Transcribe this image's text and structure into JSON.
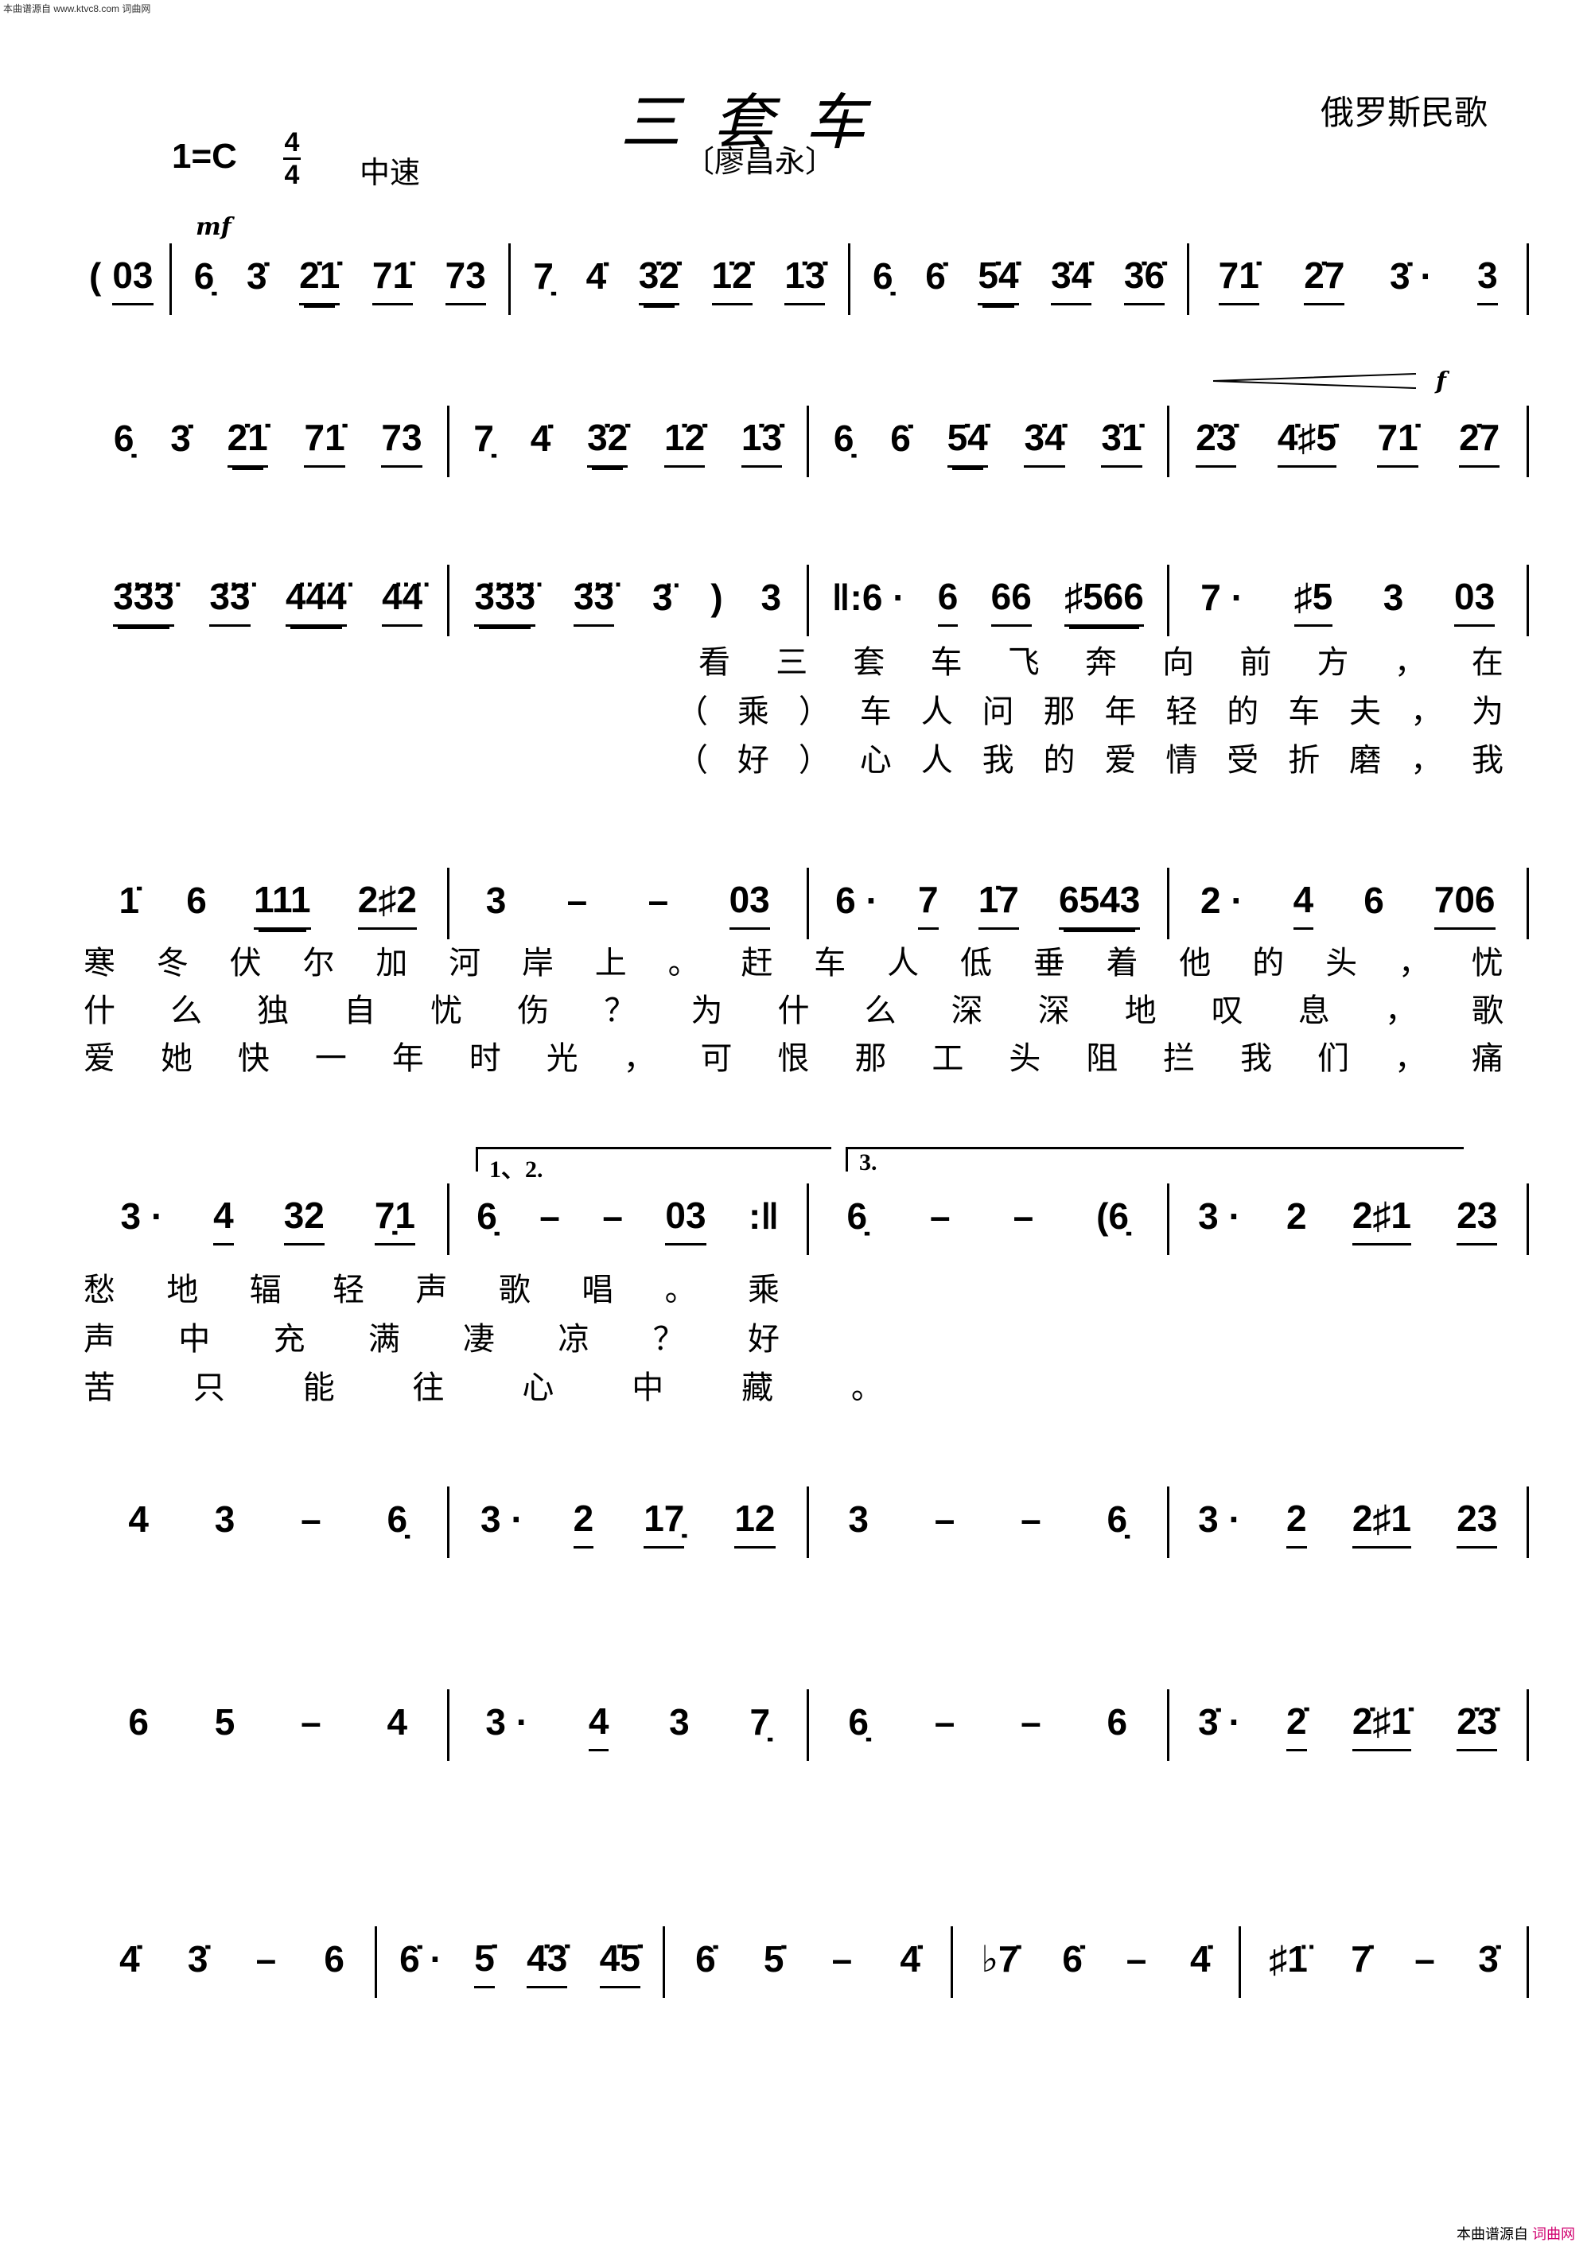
{
  "watermark_top": "本曲谱源自 www.ktvc8.com 词曲网",
  "title": "三套车",
  "composer": "俄罗斯民歌",
  "arranger": "〔廖昌永〕",
  "key": "1=C",
  "time_signature": {
    "top": "4",
    "bottom": "4"
  },
  "tempo": "中速",
  "dynamics": {
    "mf": "mf",
    "f": "f"
  },
  "voltas": {
    "first": "1、2.",
    "second": "3."
  },
  "rows": [
    {
      "lead": [
        "(",
        {
          "t": "03",
          "u": 1
        }
      ],
      "measures": [
        [
          "6̣",
          "3̇",
          {
            "t": "2̇1̇",
            "u": 2
          },
          {
            "t": "71̇",
            "u": 1
          },
          {
            "t": "73",
            "u": 1
          }
        ],
        [
          "7̣",
          "4̇",
          {
            "t": "3̇2̇",
            "u": 2
          },
          {
            "t": "1̇2̇",
            "u": 1
          },
          {
            "t": "1̇3̇",
            "u": 1
          }
        ],
        [
          "6̣",
          "6̇",
          {
            "t": "5̇4̇",
            "u": 2
          },
          {
            "t": "3̇4̇",
            "u": 1
          },
          {
            "t": "3̇6̇",
            "u": 1
          }
        ],
        [
          {
            "t": "71̇",
            "u": 1
          },
          {
            "t": "2̇7",
            "u": 1
          },
          "3̇ ·",
          {
            "t": "3",
            "u": 1
          }
        ]
      ]
    },
    {
      "lead": [],
      "measures": [
        [
          "6̣",
          "3̇",
          {
            "t": "2̇1̇",
            "u": 2
          },
          {
            "t": "71̇",
            "u": 1
          },
          {
            "t": "73",
            "u": 1
          }
        ],
        [
          "7̣",
          "4̇",
          {
            "t": "3̇2̇",
            "u": 2
          },
          {
            "t": "1̇2̇",
            "u": 1
          },
          {
            "t": "1̇3̇",
            "u": 1
          }
        ],
        [
          "6̣",
          "6̇",
          {
            "t": "5̇4̇",
            "u": 2
          },
          {
            "t": "3̇4̇",
            "u": 1
          },
          {
            "t": "3̇1̇",
            "u": 1
          }
        ],
        [
          {
            "t": "2̇3̇",
            "u": 1
          },
          {
            "t": "4̇♯5̇",
            "u": 1
          },
          {
            "t": "71̇",
            "u": 1
          },
          {
            "t": "2̇7",
            "u": 1
          }
        ]
      ]
    },
    {
      "lead": [],
      "measures": [
        [
          {
            "t": "3̈3̈3̈",
            "u": 2
          },
          {
            "t": "3̈3̈",
            "u": 1
          },
          {
            "t": "4̈4̈4̈",
            "u": 2
          },
          {
            "t": "4̈4̈",
            "u": 1
          }
        ],
        [
          {
            "t": "3̈3̈3̈",
            "u": 2
          },
          {
            "t": "3̈3̈",
            "u": 1
          },
          "3̈",
          ")",
          "3"
        ],
        [
          "‖:6 ·",
          {
            "t": "6",
            "u": 1
          },
          {
            "t": "66",
            "u": 1
          },
          {
            "t": "♯566",
            "u": 2
          }
        ],
        [
          "7 ·",
          {
            "t": "♯5",
            "u": 1
          },
          "3",
          {
            "t": "03",
            "u": 1
          }
        ]
      ]
    },
    {
      "lead": [],
      "measures": [
        [
          "1̇",
          "6",
          {
            "t": "111",
            "u": 2
          },
          {
            "t": "2♯2",
            "u": 1
          }
        ],
        [
          "3",
          "–",
          "–",
          {
            "t": "03",
            "u": 1
          }
        ],
        [
          "6 ·",
          {
            "t": "7",
            "u": 1
          },
          {
            "t": "1̇7",
            "u": 1
          },
          {
            "t": "6543",
            "u": 2
          }
        ],
        [
          "2 ·",
          {
            "t": "4",
            "u": 1
          },
          "6",
          {
            "t": "706",
            "u": 1
          }
        ]
      ]
    },
    {
      "lead": [],
      "measures": [
        [
          "3 ·",
          {
            "t": "4",
            "u": 1
          },
          {
            "t": "32",
            "u": 1
          },
          {
            "t": "7̣1",
            "u": 1
          }
        ],
        [
          "6̣",
          "–",
          "–",
          {
            "t": "03",
            "u": 1
          },
          ":‖"
        ],
        [
          "6̣",
          "–",
          "–",
          "(6̣"
        ],
        [
          "3 ·",
          "2",
          {
            "t": "2♯1",
            "u": 1
          },
          {
            "t": "23",
            "u": 1
          }
        ]
      ]
    },
    {
      "lead": [],
      "measures": [
        [
          "4",
          "3",
          "–",
          "6̣"
        ],
        [
          "3 ·",
          {
            "t": "2",
            "u": 1
          },
          {
            "t": "17̣",
            "u": 1
          },
          {
            "t": "12",
            "u": 1
          }
        ],
        [
          "3",
          "–",
          "–",
          "6̣"
        ],
        [
          "3 ·",
          {
            "t": "2",
            "u": 1
          },
          {
            "t": "2♯1",
            "u": 1
          },
          {
            "t": "23",
            "u": 1
          }
        ]
      ]
    },
    {
      "lead": [],
      "measures": [
        [
          "6",
          "5",
          "–",
          "4"
        ],
        [
          "3 ·",
          {
            "t": "4",
            "u": 1
          },
          "3",
          "7̣"
        ],
        [
          "6̣",
          "–",
          "–",
          "6"
        ],
        [
          "3̇ ·",
          {
            "t": "2̇",
            "u": 1
          },
          {
            "t": "2̇♯1̇",
            "u": 1
          },
          {
            "t": "2̇3̇",
            "u": 1
          }
        ]
      ]
    },
    {
      "lead": [],
      "measures": [
        [
          "4̇",
          "3̇",
          "–",
          "6"
        ],
        [
          "6̇ ·",
          {
            "t": "5̇",
            "u": 1
          },
          {
            "t": "4̇3̇",
            "u": 1
          },
          {
            "t": "4̇5̇",
            "u": 1
          }
        ],
        [
          "6̇",
          "5̇",
          "–",
          "4̇"
        ],
        [
          "♭7̇",
          "6̇",
          "–",
          "4̇"
        ],
        [
          "♯1̈",
          "7̇",
          "–",
          "3̇"
        ]
      ]
    }
  ],
  "lyrics": {
    "row3": [
      "看三套车飞奔向前方，在",
      "（乘）车人问那年轻的车夫，为",
      "（好）心人我的爱情受折磨，我"
    ],
    "row4": [
      "寒冬伏尔加河岸上。赶车人低垂着他的头，忧",
      "什么独自忧伤？为什么深深地叹息，歌",
      "爱她快一年时光，可恨那工头阻拦我们，痛"
    ],
    "row5": [
      "愁地辐轻声歌唱。乘",
      "声中充满凄凉？好",
      "苦只能往心中藏。"
    ]
  },
  "footer": {
    "source": "本曲谱源自",
    "brand": "词曲网"
  }
}
